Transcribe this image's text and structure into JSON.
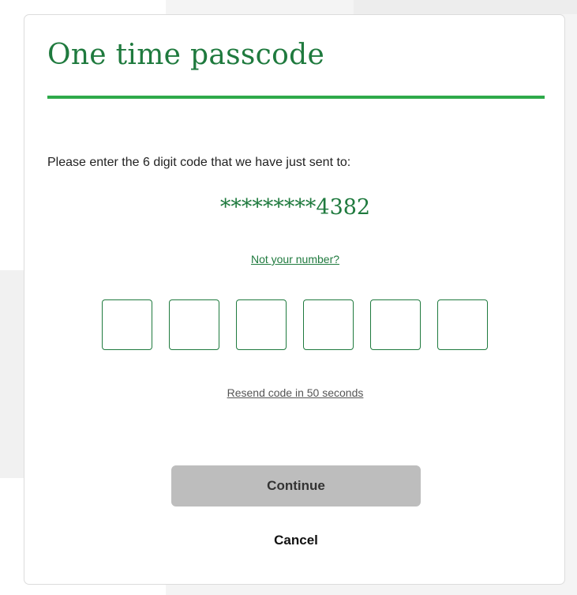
{
  "header": {
    "title": "One time passcode"
  },
  "body": {
    "instruction": "Please enter the 6 digit code that we have just sent to:",
    "masked_number": "*********4382",
    "not_your_number": "Not your number?",
    "resend": "Resend code in 50 seconds"
  },
  "otp": {
    "length": 6,
    "values": [
      "",
      "",
      "",
      "",
      "",
      ""
    ]
  },
  "actions": {
    "continue": "Continue",
    "cancel": "Cancel"
  },
  "colors": {
    "brand_green": "#1f7a3e",
    "accent_green": "#2eaa4a",
    "disabled_button": "#bdbdbd"
  }
}
